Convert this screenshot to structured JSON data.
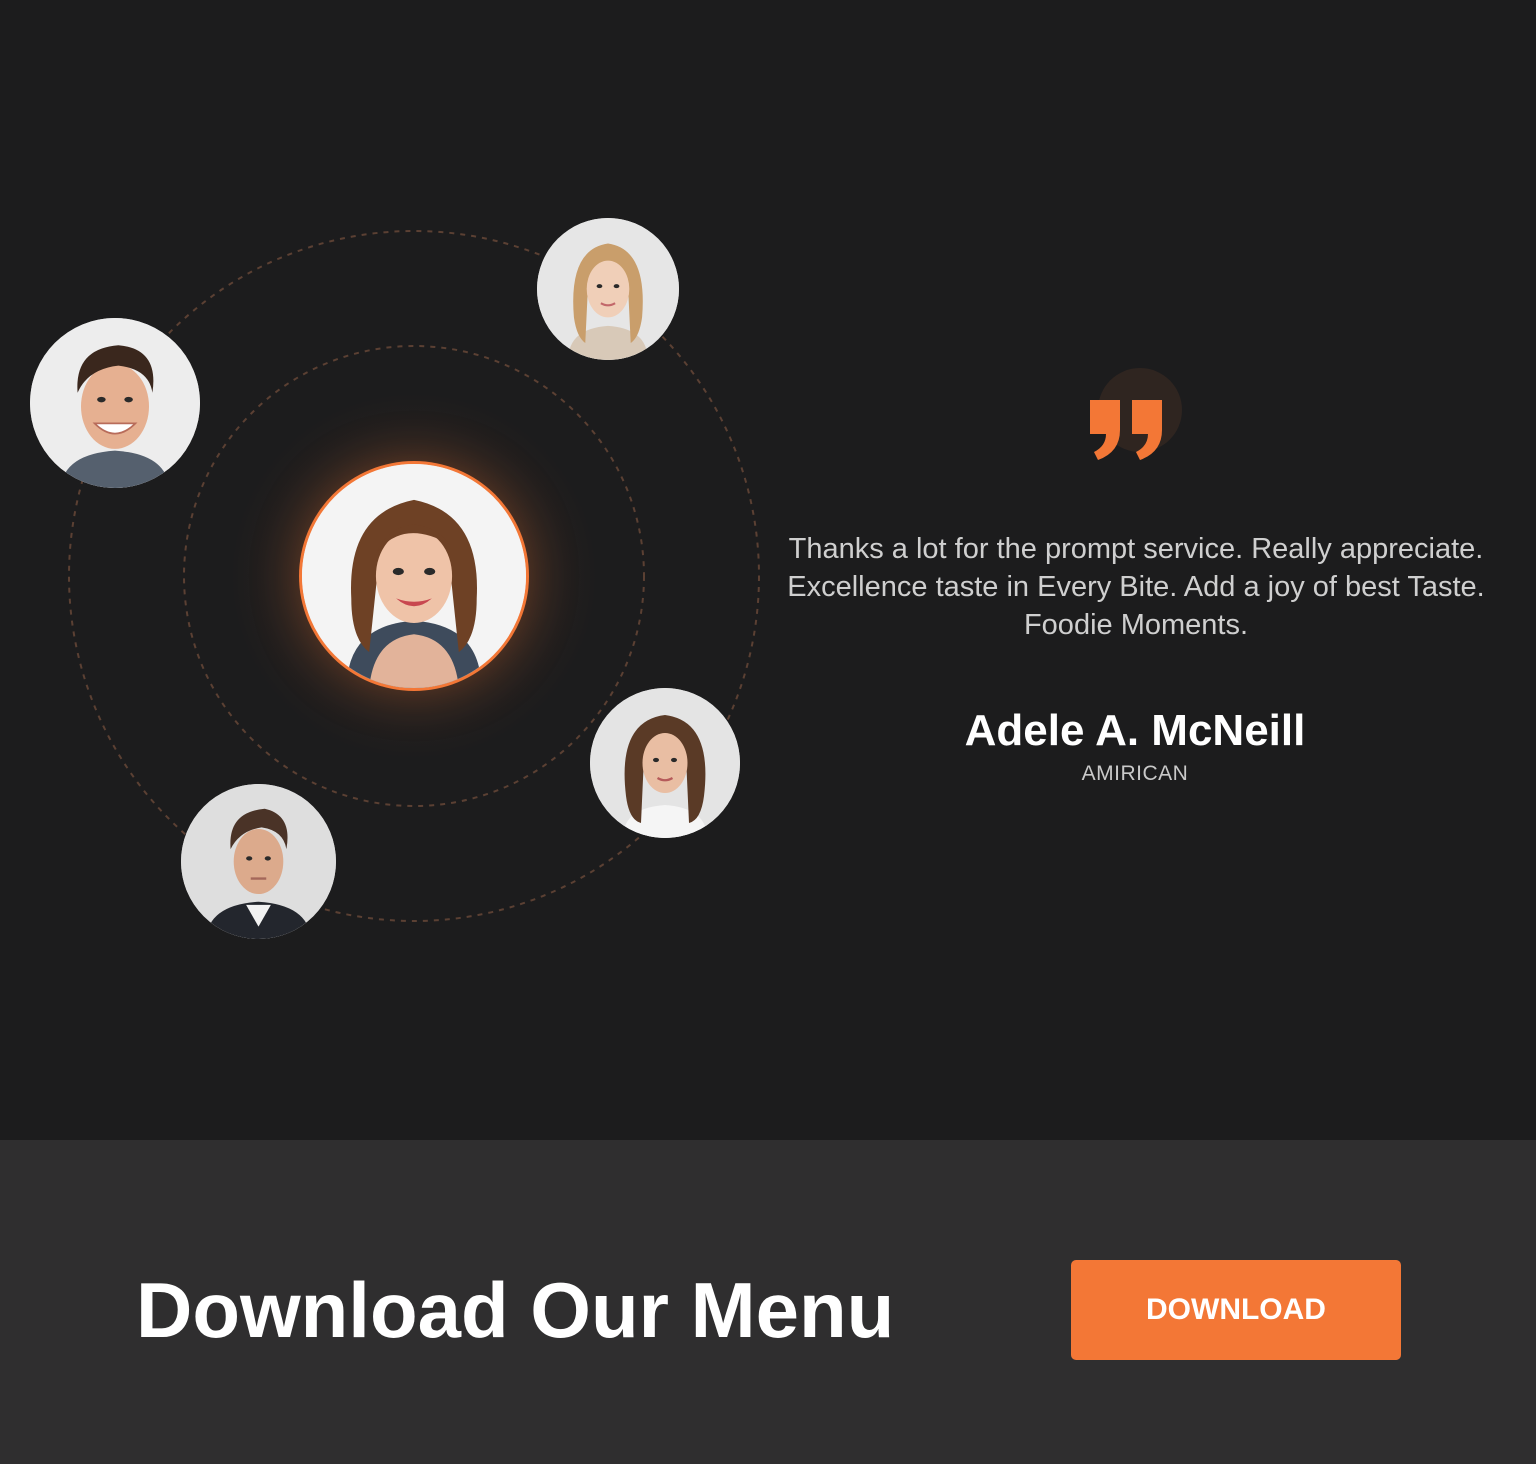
{
  "colors": {
    "accent": "#f37736",
    "background": "#1c1c1d",
    "download_band": "#2f2e2f",
    "quote_text": "#cfcfcf"
  },
  "testimonial": {
    "quote_icon": "double-quote-icon",
    "text": "Thanks a lot for the prompt service. Really appreciate. Excellence taste in Every Bite. Add a joy of best Taste. Foodie Moments.",
    "author_name": "Adele A. McNeill",
    "author_origin": "AMIRICAN",
    "avatars": [
      {
        "name": "featured-customer-avatar",
        "role": "selected"
      },
      {
        "name": "customer-avatar-man-smiling"
      },
      {
        "name": "customer-avatar-woman-blonde"
      },
      {
        "name": "customer-avatar-woman-brunette"
      },
      {
        "name": "customer-avatar-man-suit"
      }
    ]
  },
  "download": {
    "title": "Download Our Menu",
    "button_label": "DOWNLOAD"
  }
}
